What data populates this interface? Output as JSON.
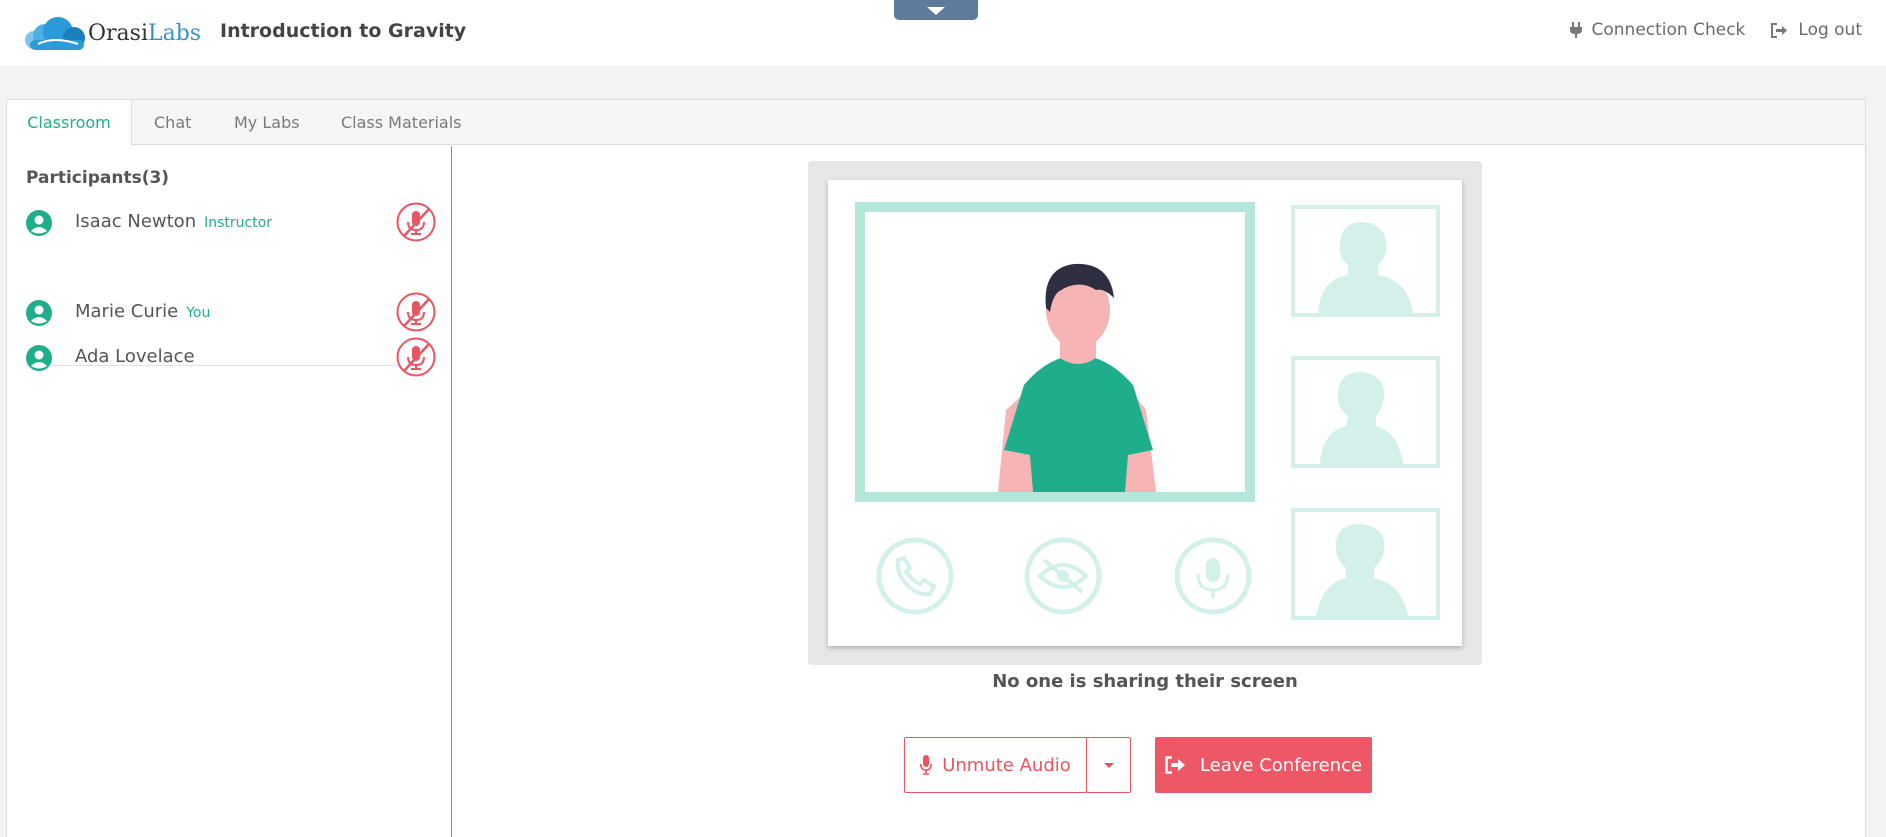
{
  "header": {
    "logo_word_1": "Orasi",
    "logo_word_2": "Labs",
    "course_title": "Introduction to Gravity",
    "connection_check": "Connection Check",
    "log_out": "Log out"
  },
  "tabs": [
    {
      "label": "Classroom",
      "active": true
    },
    {
      "label": "Chat",
      "active": false
    },
    {
      "label": "My Labs",
      "active": false
    },
    {
      "label": "Class Materials",
      "active": false
    }
  ],
  "sidebar": {
    "participants_title": "Participants(3)",
    "participants": [
      {
        "name": "Isaac Newton",
        "role": "Instructor",
        "mic": "muted"
      },
      {
        "name": "Marie Curie",
        "role": "You",
        "mic": "muted"
      },
      {
        "name": "Ada Lovelace",
        "role": "",
        "mic": "muted"
      }
    ]
  },
  "content": {
    "empty_message": "No one is sharing their screen",
    "unmute_label": "Unmute Audio",
    "leave_label": "Leave Conference"
  },
  "colors": {
    "accent_green": "#1fae8c",
    "danger_red": "#ee5766",
    "toggle_blue": "#5f7b9b"
  },
  "icons": [
    "cloud-logo-icon",
    "plug-icon",
    "sign-out-icon",
    "user-circle-icon",
    "mic-muted-icon",
    "microphone-icon",
    "caret-down-icon",
    "phone-icon",
    "eye-slash-icon"
  ]
}
